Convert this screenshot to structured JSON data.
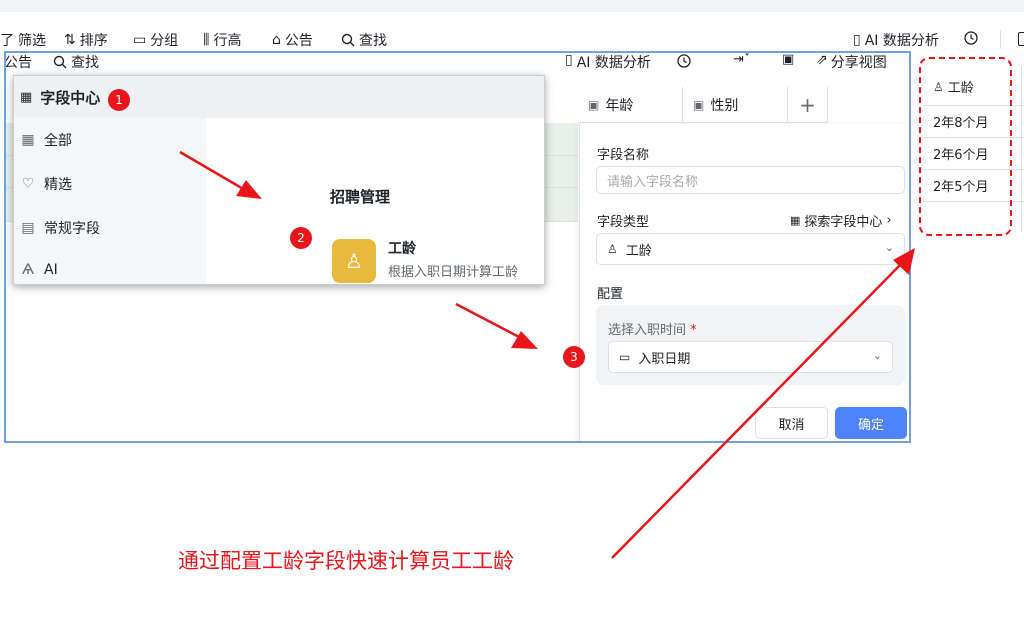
{
  "top_toolbar": {
    "items": [
      {
        "icon": "filter-icon",
        "glyph": "了",
        "label": "筛选"
      },
      {
        "icon": "sort-icon",
        "glyph": "⇅",
        "label": "排序"
      },
      {
        "icon": "group-icon",
        "glyph": "▭",
        "label": "分组"
      },
      {
        "icon": "row-height-icon",
        "glyph": "⫼",
        "label": "行高"
      },
      {
        "icon": "announce-icon",
        "glyph": "⌂",
        "label": "公告"
      },
      {
        "icon": "search-icon",
        "glyph": "🔍︎",
        "label": "查找"
      }
    ],
    "ai_label": "AI 数据分析"
  },
  "inner_toolbar": {
    "announce": "公告",
    "search": "查找",
    "ai_label": "AI 数据分析",
    "share_label": "分享视图"
  },
  "columns": [
    {
      "label": "年龄"
    },
    {
      "label": "性别"
    }
  ],
  "field_center": {
    "title": "字段中心",
    "categories": [
      {
        "icon": "grid-icon",
        "label": "全部"
      },
      {
        "icon": "heart-icon",
        "label": "精选"
      },
      {
        "icon": "list-icon",
        "label": "常规字段"
      },
      {
        "icon": "ai-icon",
        "label": "AI"
      }
    ],
    "section_title": "招聘管理",
    "item": {
      "name": "工龄",
      "desc": "根据入职日期计算工龄"
    }
  },
  "field_panel": {
    "name_label": "字段名称",
    "name_placeholder": "请输入字段名称",
    "type_label": "字段类型",
    "explore_label": "探索字段中心",
    "type_value": "工龄",
    "config_label": "配置",
    "date_label": "选择入职时间",
    "required_mark": "*",
    "date_value": "入职日期",
    "cancel_label": "取消",
    "confirm_label": "确定"
  },
  "result_column": {
    "header": "工龄",
    "values": [
      "2年8个月",
      "2年6个月",
      "2年5个月"
    ]
  },
  "annotations": {
    "badges": [
      "1",
      "2",
      "3"
    ],
    "caption": "通过配置工龄字段快速计算员工工龄"
  },
  "colors": {
    "accent": "#3370ff",
    "confirm": "#4e83fd",
    "annotation_red": "#e8161b",
    "item_icon_bg": "#e9b93d"
  }
}
